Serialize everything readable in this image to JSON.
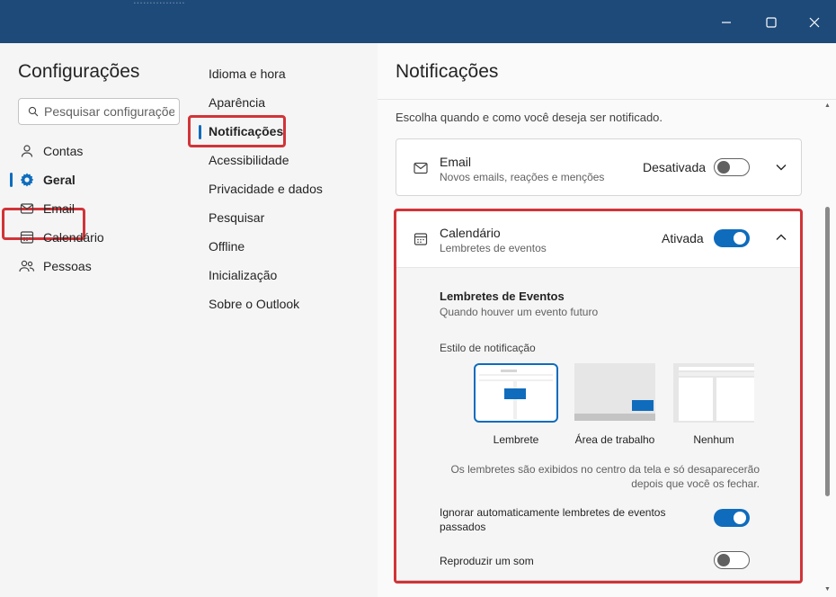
{
  "window": {
    "ghost_title": "................",
    "controls": {
      "minimize": "minimize",
      "maximize": "maximize",
      "close": "close"
    }
  },
  "settings": {
    "title": "Configurações",
    "search_placeholder": "Pesquisar configurações",
    "nav": [
      {
        "label": "Contas",
        "icon": "person-icon"
      },
      {
        "label": "Geral",
        "icon": "gear-icon",
        "active": true
      },
      {
        "label": "Email",
        "icon": "mail-icon"
      },
      {
        "label": "Calendário",
        "icon": "calendar-icon"
      },
      {
        "label": "Pessoas",
        "icon": "people-icon"
      }
    ]
  },
  "general_nav": {
    "items": [
      {
        "label": "Idioma e hora"
      },
      {
        "label": "Aparência"
      },
      {
        "label": "Notificações",
        "active": true
      },
      {
        "label": "Acessibilidade"
      },
      {
        "label": "Privacidade e dados"
      },
      {
        "label": "Pesquisar"
      },
      {
        "label": "Offline"
      },
      {
        "label": "Inicialização"
      },
      {
        "label": "Sobre o Outlook"
      }
    ]
  },
  "notifications": {
    "title": "Notificações",
    "subtitle": "Escolha quando e como você deseja ser notificado.",
    "email": {
      "title": "Email",
      "subtitle": "Novos emails, reações e menções",
      "state_label": "Desativada",
      "enabled": false
    },
    "calendar": {
      "title": "Calendário",
      "subtitle": "Lembretes de eventos",
      "state_label": "Ativada",
      "enabled": true,
      "section_title": "Lembretes de Eventos",
      "section_sub": "Quando houver um evento futuro",
      "style_label": "Estilo de notificação",
      "options": [
        {
          "label": "Lembrete",
          "selected": true
        },
        {
          "label": "Área de trabalho",
          "selected": false
        },
        {
          "label": "Nenhum",
          "selected": false
        }
      ],
      "description_line1": "Os lembretes são exibidos no centro da tela e só desaparecerão",
      "description_line2": "depois que você os fechar.",
      "auto_dismiss_line1": "Ignorar automaticamente lembretes de eventos",
      "auto_dismiss_line2": "passados",
      "auto_dismiss_enabled": true,
      "sound_label": "Reproduzir um som",
      "sound_enabled": false
    }
  },
  "colors": {
    "titlebar": "#1e4a7a",
    "accent": "#0f6cbd",
    "highlight": "#d13438"
  }
}
